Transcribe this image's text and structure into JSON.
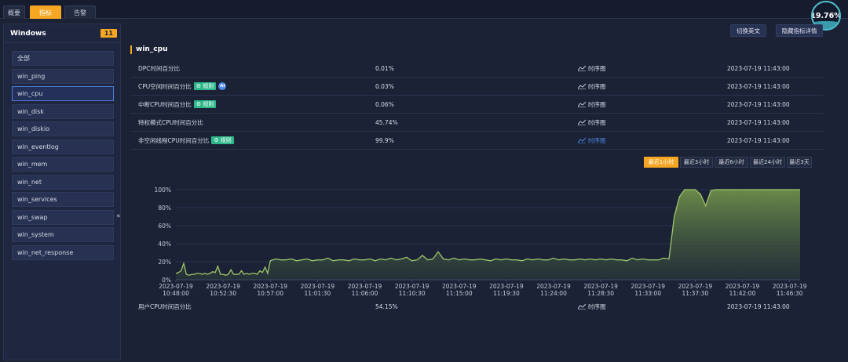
{
  "top_tabs": [
    "概要",
    "指标",
    "告警"
  ],
  "active_tab_index": 1,
  "gauge_value": "19.76%",
  "sidebar": {
    "title": "Windows",
    "count": "11",
    "items": [
      {
        "label": "全部"
      },
      {
        "label": "win_ping"
      },
      {
        "label": "win_cpu"
      },
      {
        "label": "win_disk"
      },
      {
        "label": "win_diskio"
      },
      {
        "label": "win_eventlog"
      },
      {
        "label": "win_mem"
      },
      {
        "label": "win_net"
      },
      {
        "label": "win_services"
      },
      {
        "label": "win_swap"
      },
      {
        "label": "win_system"
      },
      {
        "label": "win_net_response"
      }
    ],
    "active_index": 2,
    "collapse_glyph": "«"
  },
  "toolbar": {
    "switch_lang": "切换英文",
    "hide_details": "隐藏指标详情"
  },
  "section_title": "win_cpu",
  "metrics": [
    {
      "name": "DPC时间百分比",
      "value": "0.01%",
      "chart_label": "时序图",
      "time": "2023-07-19 11:43:00"
    },
    {
      "name": "CPU空闲时间百分比",
      "tag": "规则",
      "ai": "AI",
      "value": "0.03%",
      "chart_label": "时序图",
      "time": "2023-07-19 11:43:00"
    },
    {
      "name": "中断CPU时间百分比",
      "tag": "规则",
      "value": "0.06%",
      "chart_label": "时序图",
      "time": "2023-07-19 11:43:00"
    },
    {
      "name": "特权模式CPU时间百分比",
      "value": "45.74%",
      "chart_label": "时序图",
      "time": "2023-07-19 11:43:00"
    },
    {
      "name": "非空闲线程CPU时间百分比",
      "tag": "规则",
      "value": "99.9%",
      "chart_label": "时序图",
      "time": "2023-07-19 11:43:00",
      "selected": true
    }
  ],
  "time_ranges": [
    "最近1小时",
    "最近3小时",
    "最近6小时",
    "最近24小时",
    "最近3天"
  ],
  "active_range_index": 0,
  "bottom_metric": {
    "name": "用户CPU时间百分比",
    "value": "54.15%",
    "chart_label": "时序图",
    "time": "2023-07-19 11:43:00"
  },
  "colors": {
    "accent": "#f5a623",
    "line": "#9fc56a",
    "tag": "#2eb88a",
    "link": "#4d88e6"
  },
  "chart_data": {
    "type": "area",
    "title": "",
    "xlabel": "",
    "ylabel": "",
    "ylim": [
      0,
      100
    ],
    "y_ticks": [
      "0%",
      "20%",
      "40%",
      "60%",
      "80%",
      "100%"
    ],
    "x_ticks": [
      [
        "2023-07-19",
        "10:48:00"
      ],
      [
        "2023-07-19",
        "10:52:30"
      ],
      [
        "2023-07-19",
        "10:57:00"
      ],
      [
        "2023-07-19",
        "11:01:30"
      ],
      [
        "2023-07-19",
        "11:06:00"
      ],
      [
        "2023-07-19",
        "11:10:30"
      ],
      [
        "2023-07-19",
        "11:15:00"
      ],
      [
        "2023-07-19",
        "11:19:30"
      ],
      [
        "2023-07-19",
        "11:24:00"
      ],
      [
        "2023-07-19",
        "11:28:30"
      ],
      [
        "2023-07-19",
        "11:33:00"
      ],
      [
        "2023-07-19",
        "11:37:30"
      ],
      [
        "2023-07-19",
        "11:42:00"
      ],
      [
        "2023-07-19",
        "11:46:30"
      ]
    ],
    "x_start": "10:48:00",
    "x_end": "11:47:30",
    "series": [
      {
        "values": [
          [
            0,
            7
          ],
          [
            0.25,
            8
          ],
          [
            0.5,
            10
          ],
          [
            0.75,
            18
          ],
          [
            1,
            6
          ],
          [
            1.25,
            5
          ],
          [
            1.5,
            6
          ],
          [
            1.75,
            6
          ],
          [
            2,
            7
          ],
          [
            2.25,
            7
          ],
          [
            2.5,
            6
          ],
          [
            2.75,
            7
          ],
          [
            3,
            6
          ],
          [
            3.25,
            7
          ],
          [
            3.5,
            9
          ],
          [
            3.75,
            8
          ],
          [
            4,
            15
          ],
          [
            4.25,
            6
          ],
          [
            4.5,
            6
          ],
          [
            4.75,
            5
          ],
          [
            5,
            6
          ],
          [
            5.25,
            11
          ],
          [
            5.5,
            6
          ],
          [
            5.75,
            6
          ],
          [
            6,
            6
          ],
          [
            6.25,
            10
          ],
          [
            6.5,
            6
          ],
          [
            6.75,
            7
          ],
          [
            7,
            6
          ],
          [
            7.25,
            7
          ],
          [
            7.5,
            7
          ],
          [
            7.75,
            6
          ],
          [
            8,
            10
          ],
          [
            8.25,
            8
          ],
          [
            8.5,
            14
          ],
          [
            8.75,
            7
          ],
          [
            9,
            21
          ],
          [
            9.5,
            23
          ],
          [
            10,
            22
          ],
          [
            10.5,
            22
          ],
          [
            11,
            23
          ],
          [
            11.5,
            21
          ],
          [
            12,
            22
          ],
          [
            12.5,
            23
          ],
          [
            13,
            21
          ],
          [
            13.5,
            22
          ],
          [
            14,
            22
          ],
          [
            14.5,
            24
          ],
          [
            15,
            21
          ],
          [
            15.5,
            22
          ],
          [
            16,
            22
          ],
          [
            16.5,
            21
          ],
          [
            17,
            23
          ],
          [
            17.5,
            22
          ],
          [
            18,
            22
          ],
          [
            18.5,
            23
          ],
          [
            19,
            21
          ],
          [
            19.5,
            23
          ],
          [
            20,
            22
          ],
          [
            20.5,
            24
          ],
          [
            21,
            22
          ],
          [
            21.5,
            23
          ],
          [
            22,
            25
          ],
          [
            22.5,
            21
          ],
          [
            23,
            22
          ],
          [
            23.5,
            27
          ],
          [
            24,
            22
          ],
          [
            24.5,
            23
          ],
          [
            25,
            31
          ],
          [
            25.5,
            23
          ],
          [
            26,
            22
          ],
          [
            26.5,
            24
          ],
          [
            27,
            22
          ],
          [
            27.5,
            23
          ],
          [
            28,
            22
          ],
          [
            28.5,
            22
          ],
          [
            29,
            23
          ],
          [
            29.5,
            22
          ],
          [
            30,
            21
          ],
          [
            30.5,
            23
          ],
          [
            31,
            22
          ],
          [
            31.5,
            23
          ],
          [
            32,
            22
          ],
          [
            32.5,
            22
          ],
          [
            33,
            21
          ],
          [
            33.5,
            23
          ],
          [
            34,
            22
          ],
          [
            34.5,
            23
          ],
          [
            35,
            22
          ],
          [
            35.5,
            22
          ],
          [
            36,
            24
          ],
          [
            36.5,
            22
          ],
          [
            37,
            23
          ],
          [
            37.5,
            22
          ],
          [
            38,
            22
          ],
          [
            38.5,
            23
          ],
          [
            39,
            22
          ],
          [
            39.5,
            23
          ],
          [
            40,
            22
          ],
          [
            40.5,
            23
          ],
          [
            41,
            22
          ],
          [
            41.5,
            23
          ],
          [
            42,
            22
          ],
          [
            42.5,
            22
          ],
          [
            43,
            21
          ],
          [
            43.5,
            24
          ],
          [
            44,
            22
          ],
          [
            44.5,
            23
          ],
          [
            45,
            22
          ],
          [
            45.5,
            22
          ],
          [
            46,
            22
          ],
          [
            46.5,
            24
          ],
          [
            47,
            23
          ],
          [
            47.5,
            70
          ],
          [
            48,
            92
          ],
          [
            48.5,
            100
          ],
          [
            49,
            100
          ],
          [
            49.5,
            100
          ],
          [
            50,
            95
          ],
          [
            50.5,
            82
          ],
          [
            51,
            99
          ],
          [
            51.5,
            100
          ],
          [
            52,
            100
          ],
          [
            53,
            100
          ],
          [
            54,
            100
          ],
          [
            55,
            100
          ],
          [
            56,
            100
          ],
          [
            57,
            100
          ],
          [
            58,
            100
          ],
          [
            59,
            100
          ],
          [
            59.5,
            100
          ]
        ]
      }
    ],
    "grid": true
  }
}
